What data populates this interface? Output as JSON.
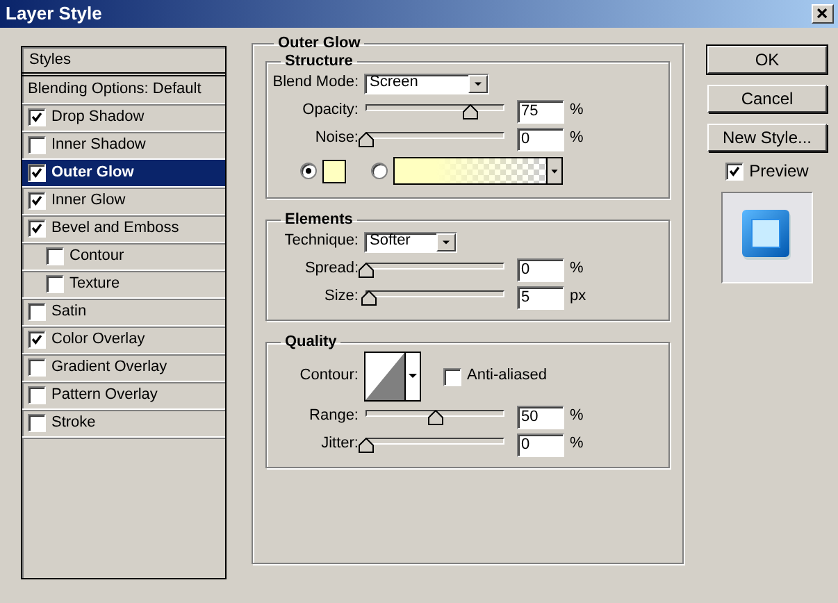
{
  "window": {
    "title": "Layer Style"
  },
  "styles_panel": {
    "header": "Styles",
    "items": [
      {
        "label": "Blending Options: Default",
        "kind": "option",
        "selected": false
      },
      {
        "label": "Drop Shadow",
        "kind": "effect",
        "checked": true,
        "selected": false
      },
      {
        "label": "Inner Shadow",
        "kind": "effect",
        "checked": false,
        "selected": false
      },
      {
        "label": "Outer Glow",
        "kind": "effect",
        "checked": true,
        "selected": true
      },
      {
        "label": "Inner Glow",
        "kind": "effect",
        "checked": true,
        "selected": false
      },
      {
        "label": "Bevel and Emboss",
        "kind": "effect",
        "checked": true,
        "selected": false,
        "children": [
          {
            "label": "Contour",
            "kind": "effect",
            "checked": false,
            "selected": false
          },
          {
            "label": "Texture",
            "kind": "effect",
            "checked": false,
            "selected": false
          }
        ]
      },
      {
        "label": "Satin",
        "kind": "effect",
        "checked": false,
        "selected": false
      },
      {
        "label": "Color Overlay",
        "kind": "effect",
        "checked": true,
        "selected": false
      },
      {
        "label": "Gradient Overlay",
        "kind": "effect",
        "checked": false,
        "selected": false
      },
      {
        "label": "Pattern Overlay",
        "kind": "effect",
        "checked": false,
        "selected": false
      },
      {
        "label": "Stroke",
        "kind": "effect",
        "checked": false,
        "selected": false
      }
    ]
  },
  "outer_glow": {
    "title": "Outer Glow",
    "structure": {
      "title": "Structure",
      "blend_mode": {
        "label": "Blend Mode:",
        "value": "Screen"
      },
      "sliders": [
        {
          "label": "Opacity:",
          "level": 0.75,
          "value": "75",
          "unit": "%"
        },
        {
          "label": "Noise:",
          "level": 0,
          "value": "0",
          "unit": "%"
        }
      ],
      "fill_modes": [
        {
          "kind": "solid",
          "selected": true
        },
        {
          "kind": "gradient",
          "selected": false
        }
      ]
    },
    "elements": {
      "title": "Elements",
      "technique": {
        "label": "Technique:",
        "value": "Softer"
      },
      "sliders": [
        {
          "label": "Spread:",
          "level": 0,
          "value": "0",
          "unit": "%"
        },
        {
          "label": "Size:",
          "level": 0.02,
          "value": "5",
          "unit": "px"
        }
      ]
    },
    "quality": {
      "title": "Quality",
      "contour_label": "Contour:",
      "anti_aliased": {
        "label": "Anti-aliased",
        "checked": false
      },
      "sliders": [
        {
          "label": "Range:",
          "level": 0.5,
          "value": "50",
          "unit": "%"
        },
        {
          "label": "Jitter:",
          "level": 0,
          "value": "0",
          "unit": "%"
        }
      ]
    }
  },
  "buttons": [
    "OK",
    "Cancel",
    "New Style..."
  ],
  "preview": {
    "label": "Preview",
    "checked": true
  }
}
